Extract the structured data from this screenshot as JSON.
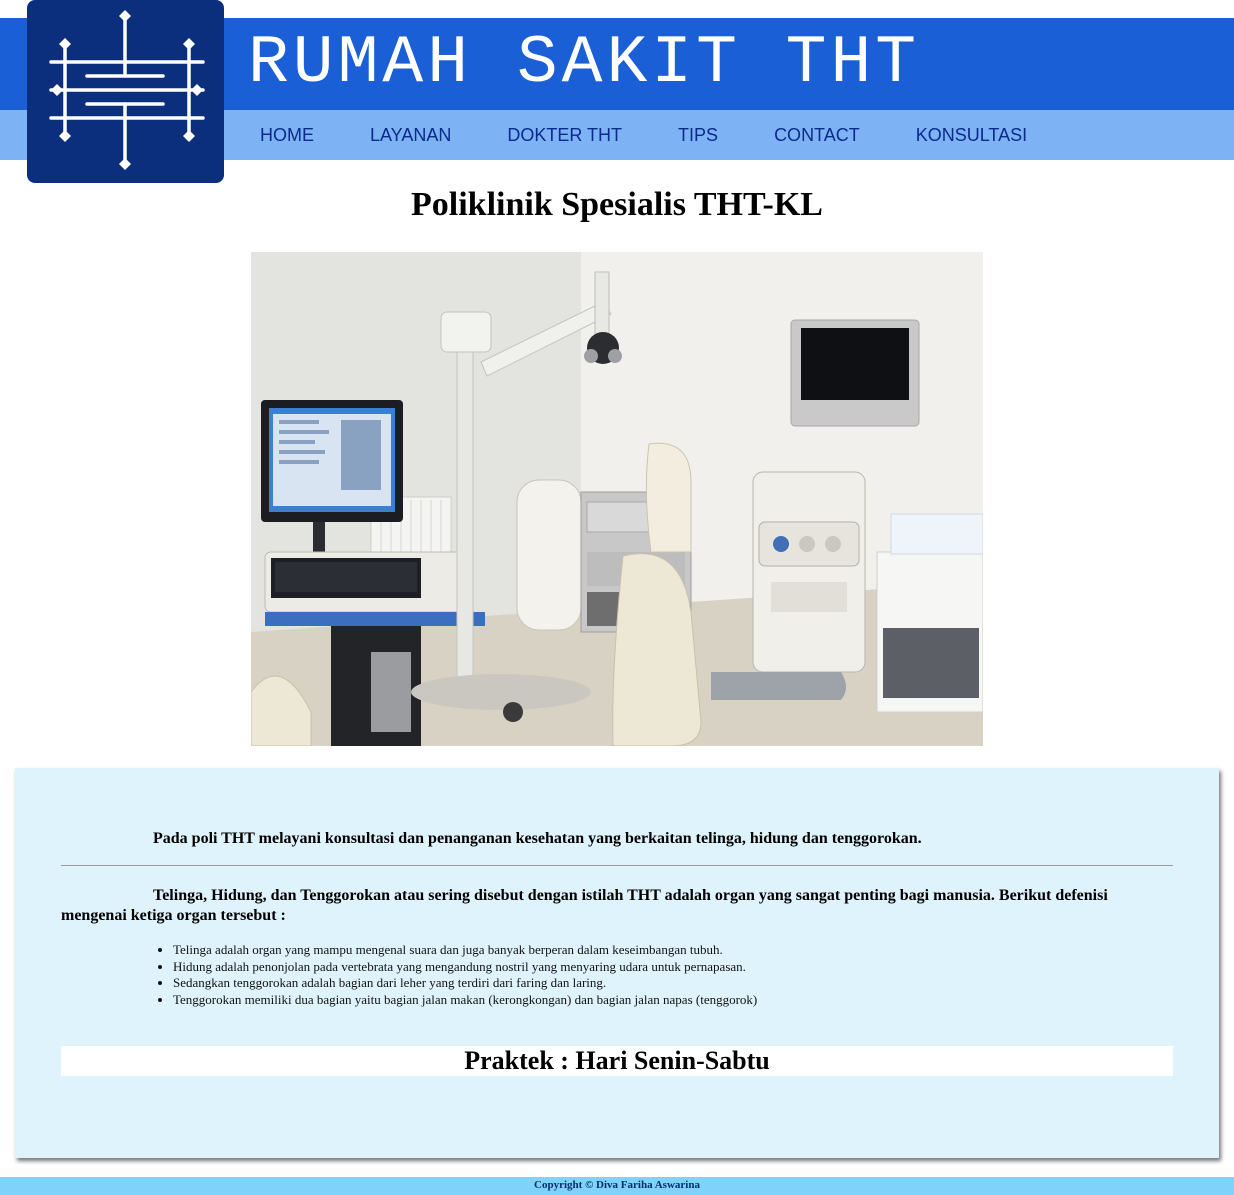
{
  "header": {
    "title": "RUMAH SAKIT THT",
    "logo_icon": "ht-monogram-icon",
    "colors": {
      "band": "#1a5fd6",
      "nav_band": "#7db3f5",
      "logo_bg": "#0b2f7d"
    }
  },
  "nav": {
    "items": [
      {
        "label": "HOME"
      },
      {
        "label": "LAYANAN"
      },
      {
        "label": "DOKTER THT"
      },
      {
        "label": "TIPS"
      },
      {
        "label": "CONTACT"
      },
      {
        "label": "KONSULTASI"
      }
    ]
  },
  "main": {
    "title": "Poliklinik Spesialis THT-KL",
    "photo_icon": "clinic-room-photo"
  },
  "content": {
    "intro": "Pada poli THT melayani konsultasi dan penanganan kesehatan yang berkaitan telinga, hidung dan tenggorokan.",
    "definition_intro": "Telinga, Hidung, dan Tenggorokan atau sering disebut dengan istilah THT adalah organ yang sangat penting bagi manusia. Berikut defenisi mengenai ketiga organ tersebut :",
    "definitions": [
      "Telinga adalah organ yang mampu mengenal suara dan juga banyak berperan dalam keseimbangan tubuh.",
      "Hidung adalah penonjolan pada vertebrata yang mengandung nostril yang menyaring udara untuk pernapasan.",
      "Sedangkan tenggorokan adalah bagian dari leher yang terdiri dari faring dan laring.",
      "Tenggorokan memiliki dua bagian yaitu bagian jalan makan (kerongkongan) dan bagian jalan napas (tenggorok)"
    ],
    "schedule": "Praktek : Hari Senin-Sabtu",
    "box_color": "#dff3fd"
  },
  "footer": {
    "copyright": "Copyright © Diva Fariha Aswarina",
    "color": "#7fd3fa"
  }
}
